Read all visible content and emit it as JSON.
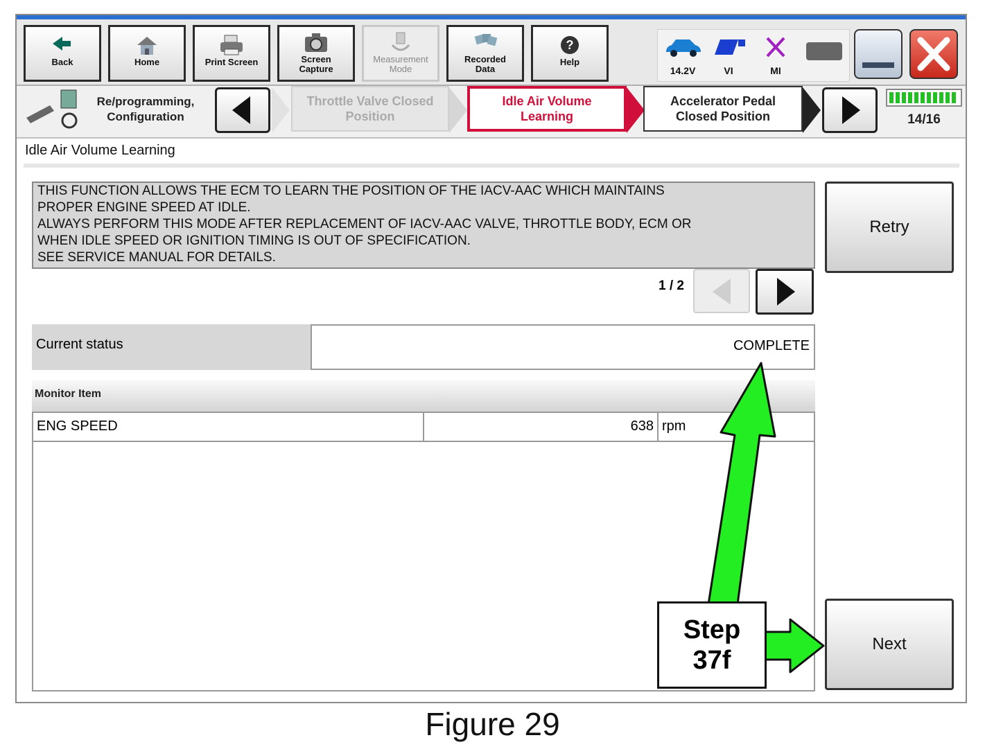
{
  "toolbar": {
    "back": "Back",
    "home": "Home",
    "print_screen": "Print Screen",
    "screen_capture": [
      "Screen",
      "Capture"
    ],
    "measurement_mode": [
      "Measurement",
      "Mode"
    ],
    "recorded_data": [
      "Recorded",
      "Data"
    ],
    "help": "Help"
  },
  "status": {
    "voltage": "14.2V",
    "vi": "VI",
    "mi": "MI"
  },
  "steps": {
    "section": [
      "Re/programming,",
      "Configuration"
    ],
    "previous": [
      "Throttle Valve Closed",
      "Position"
    ],
    "current": [
      "Idle Air Volume",
      "Learning"
    ],
    "next": [
      "Accelerator Pedal",
      "Closed Position"
    ],
    "progress": "14/16"
  },
  "page_title": "Idle Air Volume Learning",
  "description": [
    "THIS FUNCTION ALLOWS THE ECM TO LEARN THE POSITION OF THE IACV-AAC WHICH MAINTAINS",
    "PROPER ENGINE SPEED AT IDLE.",
    "ALWAYS PERFORM THIS MODE AFTER REPLACEMENT OF IACV-AAC VALVE, THROTTLE BODY, ECM OR",
    "WHEN IDLE SPEED OR IGNITION TIMING IS OUT OF SPECIFICATION.",
    "SEE SERVICE MANUAL FOR DETAILS."
  ],
  "pagination": "1 / 2",
  "current_status": {
    "label": "Current status",
    "value": "COMPLETE"
  },
  "monitor": {
    "header": "Monitor Item",
    "rows": [
      {
        "item": "ENG SPEED",
        "value": "638",
        "unit": "rpm"
      }
    ]
  },
  "buttons": {
    "retry": "Retry",
    "next": "Next"
  },
  "callout": [
    "Step",
    "37f"
  ],
  "caption": "Figure 29",
  "colors": {
    "accent_red": "#d0103a",
    "arrow_green": "#22ee22",
    "title_bar": "#2a6fd0"
  }
}
